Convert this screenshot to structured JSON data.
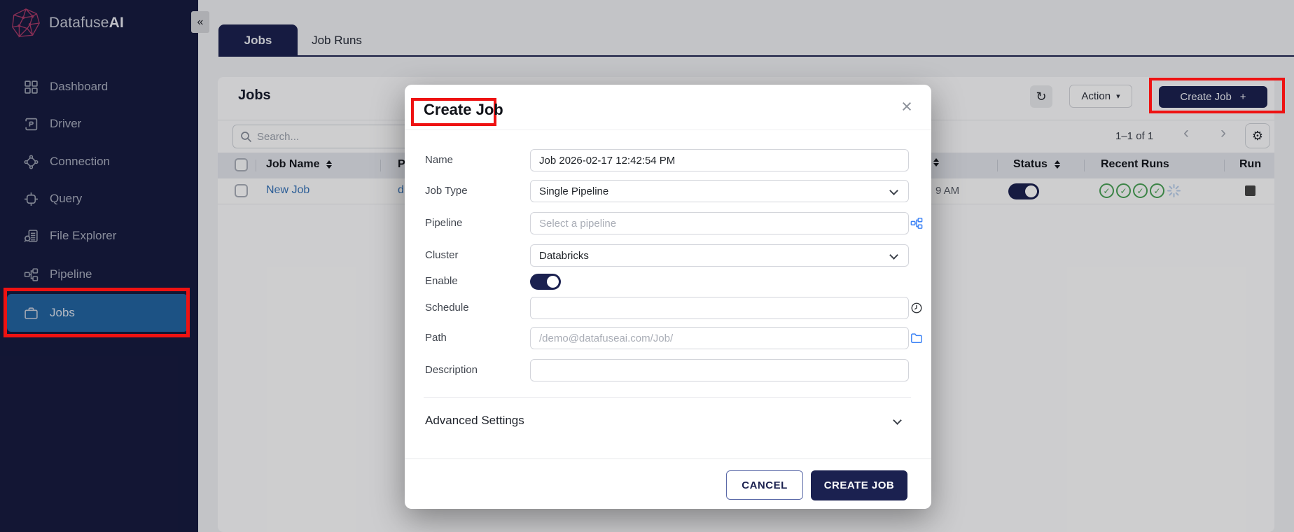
{
  "colors": {
    "navy": "#1b2150",
    "sidebar_bg": "#171b40",
    "selected_item_blue": "#2365a2",
    "link_blue": "#3572b8",
    "success_green": "#49a156",
    "annotation_red": "#ee1212",
    "logo_pink": "#a83a68"
  },
  "sidebar": {
    "logo_text": "Datafuse",
    "logo_text_bold": "AI",
    "collapse_label": "«",
    "items": [
      {
        "label": "Dashboard",
        "icon": "dashboard-grid-icon",
        "active": false
      },
      {
        "label": "Driver",
        "icon": "driver-icon",
        "active": false
      },
      {
        "label": "Connection",
        "icon": "connection-icon",
        "active": false
      },
      {
        "label": "Query",
        "icon": "query-icon",
        "active": false
      },
      {
        "label": "File Explorer",
        "icon": "file-explorer-icon",
        "active": false
      },
      {
        "label": "Pipeline",
        "icon": "pipeline-icon",
        "active": false
      },
      {
        "label": "Jobs",
        "icon": "jobs-briefcase-icon",
        "active": true,
        "annotated": true
      }
    ]
  },
  "tabs": [
    {
      "label": "Jobs",
      "active": true
    },
    {
      "label": "Job Runs",
      "active": false
    }
  ],
  "panel": {
    "title": "Jobs",
    "toolbar": {
      "refresh_icon": "↻",
      "action_label": "Action",
      "action_caret": "▾",
      "create_job_label": "Create Job",
      "create_job_plus": "+"
    },
    "search_placeholder": "Search...",
    "pagination": {
      "range_label": "1–1 of 1",
      "prev_icon": "‹",
      "next_icon": "›",
      "gear_icon": "⚙"
    },
    "table": {
      "header": {
        "job_name_label": "Job Name",
        "pipeline_partial_label": "P",
        "status_label": "Status",
        "recent_runs_label": "Recent Runs",
        "run_label": "Run"
      },
      "row": {
        "job_name": "New Job",
        "pipeline_partial": "d",
        "time_partial": "9 AM",
        "status_enabled": true,
        "recent_success_count": 4,
        "recent_running": true,
        "check_glyph": "✓"
      }
    }
  },
  "modal": {
    "title": "Create Job",
    "close_icon": "×",
    "fields": [
      {
        "label": "Name",
        "type": "text",
        "value": "Job 2026-02-17 12:42:54 PM"
      },
      {
        "label": "Job Type",
        "type": "select",
        "value": "Single Pipeline"
      },
      {
        "label": "Pipeline",
        "type": "text",
        "placeholder": "Select a pipeline",
        "icon": "pipeline-icon"
      },
      {
        "label": "Cluster",
        "type": "select",
        "value": "Databricks"
      },
      {
        "label": "Enable",
        "type": "toggle",
        "value": true
      },
      {
        "label": "Schedule",
        "type": "text",
        "value": "",
        "icon": "clock-icon"
      },
      {
        "label": "Path",
        "type": "text",
        "placeholder": "/demo@datafuseai.com/Job/",
        "icon": "folder-icon"
      },
      {
        "label": "Description",
        "type": "text",
        "value": ""
      }
    ],
    "advanced_settings_label": "Advanced Settings",
    "cancel_label": "CANCEL",
    "submit_label": "CREATE JOB"
  }
}
